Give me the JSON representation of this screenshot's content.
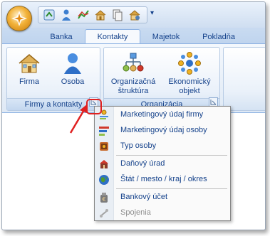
{
  "tabs": [
    {
      "label": "Banka",
      "active": false
    },
    {
      "label": "Kontakty",
      "active": true
    },
    {
      "label": "Majetok",
      "active": false
    },
    {
      "label": "Pokladňa",
      "active": false
    }
  ],
  "ribbon": {
    "groups": [
      {
        "label": "Firmy a kontakty",
        "buttons": [
          "Firma",
          "Osoba"
        ]
      },
      {
        "label": "Organizácia",
        "buttons": [
          "Organizačná štruktúra",
          "Ekonomický objekt"
        ]
      }
    ],
    "buttons": {
      "firma": "Firma",
      "osoba": "Osoba",
      "org_line1": "Organizačná",
      "org_line2": "štruktúra",
      "eko_line1": "Ekonomický",
      "eko_line2": "objekt"
    }
  },
  "menu": {
    "items": [
      {
        "label": "Marketingový údaj firmy",
        "icon": "marketing-company-icon",
        "enabled": true
      },
      {
        "label": "Marketingový údaj osoby",
        "icon": "marketing-person-icon",
        "enabled": true
      },
      {
        "label": "Typ osoby",
        "icon": "person-type-icon",
        "enabled": true
      },
      {
        "label": "Daňový úrad",
        "icon": "tax-office-icon",
        "enabled": true
      },
      {
        "label": "Štát / mesto / kraj / okres",
        "icon": "globe-icon",
        "enabled": true
      },
      {
        "label": "Bankový účet",
        "icon": "bank-account-icon",
        "enabled": true
      },
      {
        "label": "Spojenia",
        "icon": "connections-icon",
        "enabled": false
      }
    ]
  },
  "colors": {
    "text": "#15428b",
    "highlight": "#e02020"
  }
}
